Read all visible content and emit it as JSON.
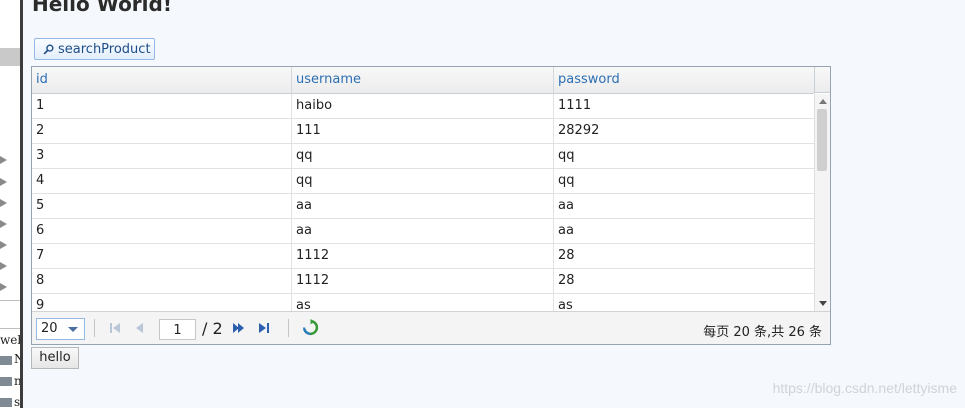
{
  "background_window": {
    "fragments": [
      "web",
      "N",
      "n",
      "s"
    ]
  },
  "page": {
    "title": "Hello World!"
  },
  "toolbar": {
    "search_label": "searchProduct"
  },
  "grid": {
    "columns": [
      "id",
      "username",
      "password"
    ],
    "rows": [
      [
        "1",
        "haibo",
        "1111"
      ],
      [
        "2",
        "111",
        "28292"
      ],
      [
        "3",
        "qq",
        "qq"
      ],
      [
        "4",
        "qq",
        "qq"
      ],
      [
        "5",
        "aa",
        "aa"
      ],
      [
        "6",
        "aa",
        "aa"
      ],
      [
        "7",
        "1112",
        "28"
      ],
      [
        "8",
        "1112",
        "28"
      ],
      [
        "9",
        "as",
        "as"
      ]
    ]
  },
  "pager": {
    "page_size": "20",
    "current_page": "1",
    "total_pages": "/ 2",
    "info": "每页 20 条,共 26 条"
  },
  "footer": {
    "hello_label": "hello"
  },
  "watermark": "https://blog.csdn.net/lettyisme",
  "colors": {
    "header_text": "#2c6fb3",
    "button_border": "#95b8e7",
    "refresh_green": "#3a9a3a"
  }
}
